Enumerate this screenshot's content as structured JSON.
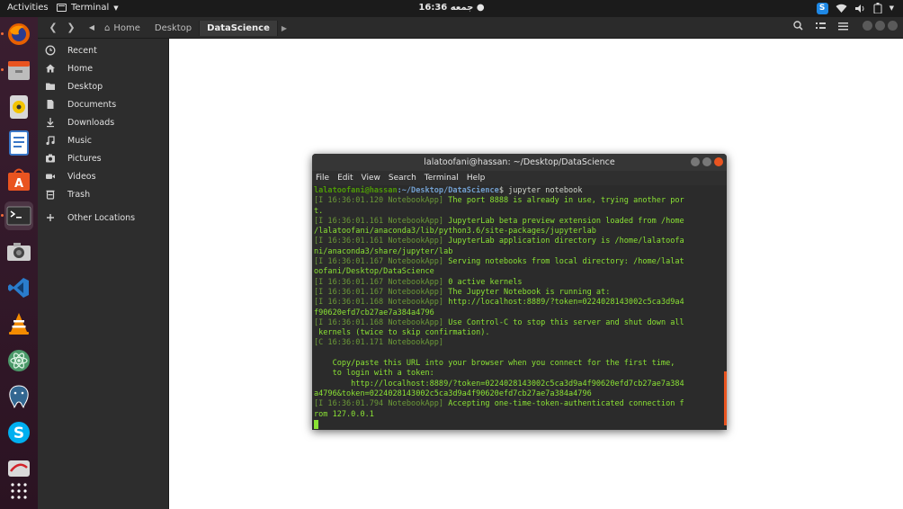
{
  "topbar": {
    "activities": "Activities",
    "app_name": "Terminal",
    "clock": "16:36 جمعه ●"
  },
  "dock": {
    "items": [
      "firefox-icon",
      "files-icon",
      "rhythmbox-icon",
      "writer-icon",
      "software-icon",
      "terminal-icon",
      "camera-icon",
      "vscode-icon",
      "vlc-icon",
      "atom-icon",
      "postgres-icon",
      "skype-icon",
      "app-icon",
      "show-apps-icon"
    ]
  },
  "filemanager": {
    "crumbs": {
      "home": "Home",
      "desktop": "Desktop",
      "current": "DataScience"
    },
    "sidebar": [
      {
        "label": "Recent",
        "icon": "clock-icon"
      },
      {
        "label": "Home",
        "icon": "home-icon"
      },
      {
        "label": "Desktop",
        "icon": "folder-icon"
      },
      {
        "label": "Documents",
        "icon": "document-icon"
      },
      {
        "label": "Downloads",
        "icon": "download-icon"
      },
      {
        "label": "Music",
        "icon": "music-icon"
      },
      {
        "label": "Pictures",
        "icon": "camera-icon"
      },
      {
        "label": "Videos",
        "icon": "video-icon"
      },
      {
        "label": "Trash",
        "icon": "trash-icon"
      },
      {
        "label": "Other Locations",
        "icon": "plus-icon"
      }
    ]
  },
  "terminal": {
    "title": "lalatoofani@hassan: ~/Desktop/DataScience",
    "menu": [
      "File",
      "Edit",
      "View",
      "Search",
      "Terminal",
      "Help"
    ],
    "prompt_user": "lalatoofani@hassan",
    "prompt_path": ":~/Desktop/DataScience",
    "prompt_cmd": "$ jupyter notebook",
    "lines": [
      {
        "tag": "[I 16:36:01.120 NotebookApp]",
        "text": " The port 8888 is already in use, trying another por"
      },
      {
        "tag": "",
        "text": "t."
      },
      {
        "tag": "[I 16:36:01.161 NotebookApp]",
        "text": " JupyterLab beta preview extension loaded from /home"
      },
      {
        "tag": "",
        "text": "/lalatoofani/anaconda3/lib/python3.6/site-packages/jupyterlab"
      },
      {
        "tag": "[I 16:36:01.161 NotebookApp]",
        "text": " JupyterLab application directory is /home/lalatoofa"
      },
      {
        "tag": "",
        "text": "ni/anaconda3/share/jupyter/lab"
      },
      {
        "tag": "[I 16:36:01.167 NotebookApp]",
        "text": " Serving notebooks from local directory: /home/lalat"
      },
      {
        "tag": "",
        "text": "oofani/Desktop/DataScience"
      },
      {
        "tag": "[I 16:36:01.167 NotebookApp]",
        "text": " 0 active kernels"
      },
      {
        "tag": "[I 16:36:01.167 NotebookApp]",
        "text": " The Jupyter Notebook is running at:"
      },
      {
        "tag": "[I 16:36:01.168 NotebookApp]",
        "text": " http://localhost:8889/?token=0224028143002c5ca3d9a4"
      },
      {
        "tag": "",
        "text": "f90620efd7cb27ae7a384a4796"
      },
      {
        "tag": "[I 16:36:01.168 NotebookApp]",
        "text": " Use Control-C to stop this server and shut down all"
      },
      {
        "tag": "",
        "text": " kernels (twice to skip confirmation)."
      },
      {
        "tag": "[C 16:36:01.171 NotebookApp]",
        "text": ""
      },
      {
        "tag": "",
        "text": ""
      },
      {
        "tag": "",
        "text": "    Copy/paste this URL into your browser when you connect for the first time,"
      },
      {
        "tag": "",
        "text": "    to login with a token:"
      },
      {
        "tag": "",
        "text": "        http://localhost:8889/?token=0224028143002c5ca3d9a4f90620efd7cb27ae7a384"
      },
      {
        "tag": "",
        "text": "a4796&token=0224028143002c5ca3d9a4f90620efd7cb27ae7a384a4796"
      },
      {
        "tag": "[I 16:36:01.794 NotebookApp]",
        "text": " Accepting one-time-token-authenticated connection f"
      },
      {
        "tag": "",
        "text": "rom 127.0.0.1"
      }
    ]
  }
}
